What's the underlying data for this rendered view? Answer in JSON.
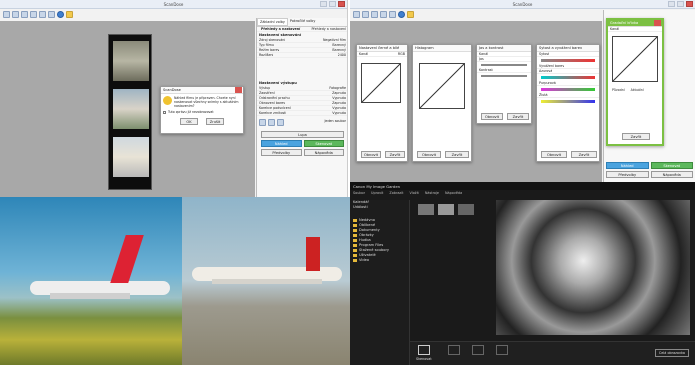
{
  "q1": {
    "window_title": "ScanDose",
    "tabs": [
      "Základní volby",
      "Pokročilé volby"
    ],
    "settings_header": "Přehledy a nastavení",
    "settings_dropdown": "Přehledy a nastavení",
    "scan_section": "Nastavení skenování",
    "scan_rows": [
      {
        "label": "Zdroj skenování",
        "value": "Negativní film"
      },
      {
        "label": "Typ filmu",
        "value": "Barevný"
      },
      {
        "label": "Režim barev",
        "value": "Barevný"
      },
      {
        "label": "Rozlišení",
        "value": "2400"
      }
    ],
    "output_section": "Nastavení výstupu",
    "output_rows": [
      {
        "label": "Výstup",
        "value": "Fotografie"
      },
      {
        "label": "Zaostření",
        "value": "Zapnuto"
      },
      {
        "label": "Odstranění prachu",
        "value": "Vypnuto"
      },
      {
        "label": "Obnovení barev",
        "value": "Zapnuto"
      },
      {
        "label": "Korekce podsvícení",
        "value": "Vypnuto"
      },
      {
        "label": "Korekce zrnitosti",
        "value": "Vypnuto"
      }
    ],
    "dropdown_bottom": "Jeden soubor",
    "btn_zoom": "Lupa",
    "btn_preview": "Náhled",
    "btn_scan": "Skenovat",
    "btn_settings": "Předvolby",
    "btn_help": "Nápověda",
    "dialog": {
      "title": "ScanDose",
      "text": "Náhled filmu je připraven. Chcete nyní naskenovat všechny snímky s aktuálním nastavením?",
      "checkbox": "Tuto zprávu již nezobrazovat",
      "ok": "OK",
      "cancel": "Zrušit"
    }
  },
  "q2": {
    "window_title": "ScanDose",
    "panel1_title": "Nastavení černé a bílé",
    "panel1_select": "Kanál",
    "panel1_select_val": "RGB",
    "panel1_ok": "Obnovit",
    "panel1_cancel": "Zavřít",
    "panel2_title": "Histogram",
    "panel2_ok": "Obnovit",
    "panel2_cancel": "Zavřít",
    "panel3_title": "Jas a kontrast",
    "panel3_labels": [
      "Kanál",
      "Jas",
      "Kontrast"
    ],
    "panel3_ok": "Obnovit",
    "panel3_cancel": "Zavřít",
    "panel4_title": "Sytost a vyvážení barev",
    "panel4_labels": [
      "Sytost",
      "Vyvážení barev",
      "Azurová",
      "Purpurová",
      "Žlutá"
    ],
    "panel4_ok": "Obnovit",
    "panel4_cancel": "Zavřít",
    "panel5_title": "Gradační křivka",
    "panel5_labels": [
      "Kanál",
      "Původní",
      "Aktuální"
    ],
    "panel5_ok": "Zavřít",
    "btn_preview": "Náhled",
    "btn_scan": "Skenovat",
    "btn_settings": "Předvolby",
    "btn_help": "Nápověda"
  },
  "q4": {
    "app_title": "Canon My Image Garden",
    "menu": [
      "Soubor",
      "Upravit",
      "Zobrazit",
      "Vložit",
      "Nástroje",
      "Nápověda"
    ],
    "side_items": [
      "Kalendář",
      "Události",
      "Nedávno",
      "Oblíbené",
      "Dokumenty",
      "Obrázky",
      "Hudba",
      "Program Files",
      "Stažené soubory",
      "Uživatelé",
      "Video"
    ],
    "bottom_label": "Skenovat",
    "status": "Celá obrazovka"
  }
}
